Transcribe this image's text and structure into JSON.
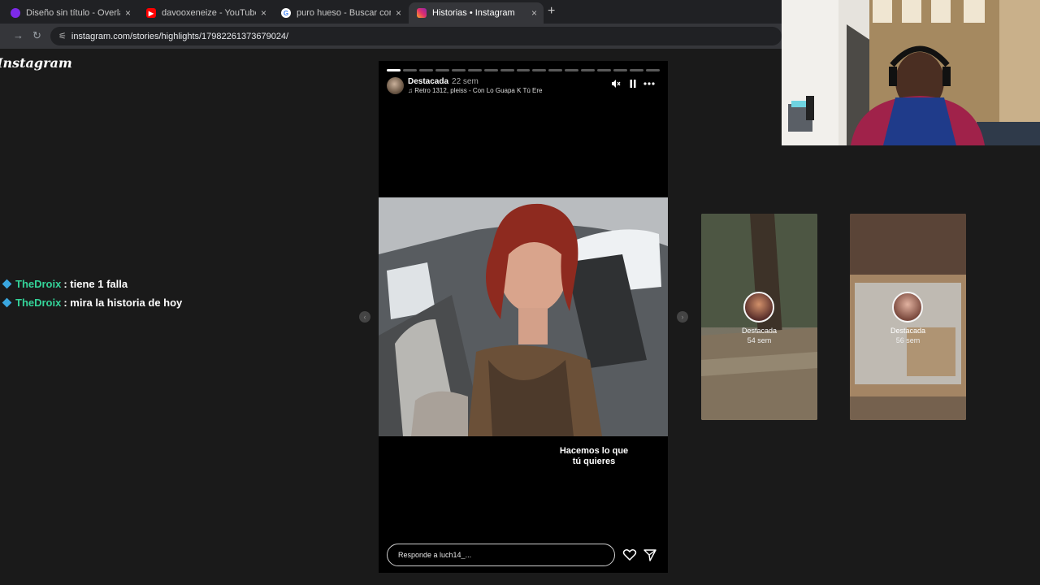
{
  "browser": {
    "tabs": [
      {
        "title": "Diseño sin título - Overlay para",
        "icon": "canva-icon",
        "color": "#7d2ae8"
      },
      {
        "title": "davooxeneize - YouTube",
        "icon": "youtube-icon",
        "color": "#ff0000"
      },
      {
        "title": "puro hueso - Buscar con Google",
        "icon": "google-icon",
        "color": "#4285f4"
      },
      {
        "title": "Historias • Instagram",
        "icon": "instagram-icon",
        "color": "#e1306c"
      }
    ],
    "close_glyph": "×",
    "new_tab_glyph": "+",
    "url": "instagram.com/stories/highlights/17982261373679024/"
  },
  "instagram": {
    "logo": "Instagram",
    "story": {
      "username": "Destacada",
      "time": "22 sem",
      "music": "Retro 1312, pleiss - Con Lo Guapa K Tú Ere",
      "caption_line1": "Hacemos lo que",
      "caption_line2": "tú quieres",
      "reply_placeholder": "Responde a luch14_...",
      "segments_total": 17,
      "segments_done": 1
    },
    "next_highlights": [
      {
        "name": "Destacada",
        "time": "54 sem"
      },
      {
        "name": "Destacada",
        "time": "56 sem"
      }
    ]
  },
  "chat": [
    {
      "user": "TheDroix",
      "message": ": tiene 1 falla"
    },
    {
      "user": "TheDroix",
      "message": ": mira la historia de hoy"
    }
  ]
}
